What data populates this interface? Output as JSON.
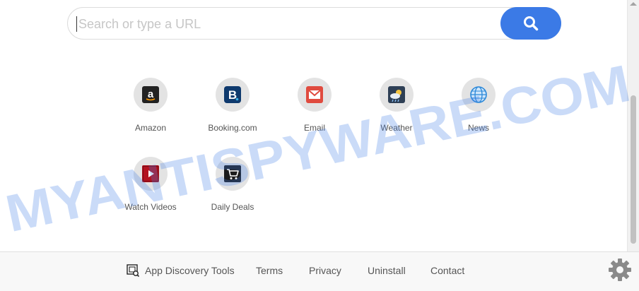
{
  "search": {
    "placeholder": "Search or type a URL",
    "button_icon": "search-icon"
  },
  "tiles": [
    {
      "label": "Amazon",
      "icon": "amazon-icon"
    },
    {
      "label": "Booking.com",
      "icon": "booking-icon"
    },
    {
      "label": "Email",
      "icon": "email-icon"
    },
    {
      "label": "Weather",
      "icon": "weather-icon"
    },
    {
      "label": "News",
      "icon": "globe-icon"
    },
    {
      "label": "Watch Videos",
      "icon": "video-play-icon"
    },
    {
      "label": "Daily Deals",
      "icon": "shopping-cart-icon"
    }
  ],
  "footer": {
    "links": [
      {
        "label": "App Discovery Tools",
        "icon": "app-discovery-icon"
      },
      {
        "label": "Terms"
      },
      {
        "label": "Privacy"
      },
      {
        "label": "Uninstall"
      },
      {
        "label": "Contact"
      }
    ],
    "settings_icon": "gear-icon"
  },
  "watermark": {
    "text": "MYANTISPYWARE.COM"
  },
  "colors": {
    "accent": "#3b7ae6",
    "tile_bg": "#e3e3e3",
    "footer_bg": "#f8f8f8",
    "watermark": "#3f7ee6"
  }
}
